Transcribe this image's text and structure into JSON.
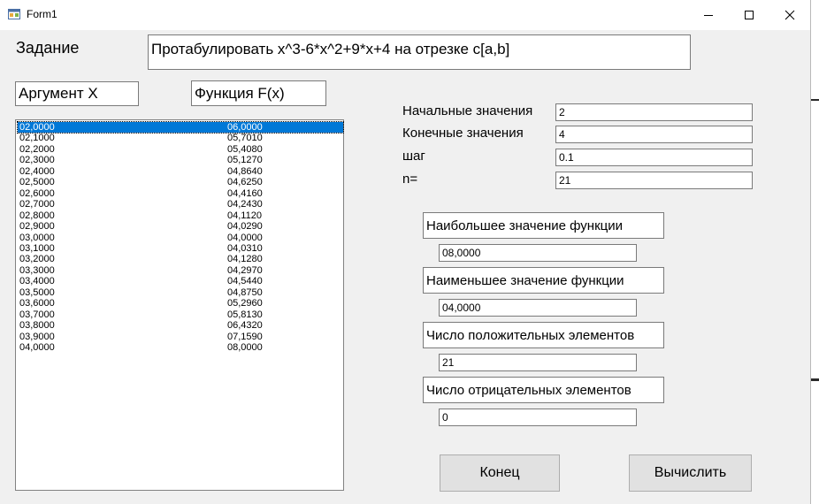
{
  "window": {
    "title": "Form1"
  },
  "task": {
    "label": "Задание",
    "text": "Протабулировать x^3-6*x^2+9*x+4 на отрезке c[a,b]"
  },
  "headers": {
    "argument": "Аргумент Х",
    "function": "Функция F(x)"
  },
  "table": {
    "rows": [
      {
        "x": "02,0000",
        "f": "06,0000"
      },
      {
        "x": "02,1000",
        "f": "05,7010"
      },
      {
        "x": "02,2000",
        "f": "05,4080"
      },
      {
        "x": "02,3000",
        "f": "05,1270"
      },
      {
        "x": "02,4000",
        "f": "04,8640"
      },
      {
        "x": "02,5000",
        "f": "04,6250"
      },
      {
        "x": "02,6000",
        "f": "04,4160"
      },
      {
        "x": "02,7000",
        "f": "04,2430"
      },
      {
        "x": "02,8000",
        "f": "04,1120"
      },
      {
        "x": "02,9000",
        "f": "04,0290"
      },
      {
        "x": "03,0000",
        "f": "04,0000"
      },
      {
        "x": "03,1000",
        "f": "04,0310"
      },
      {
        "x": "03,2000",
        "f": "04,1280"
      },
      {
        "x": "03,3000",
        "f": "04,2970"
      },
      {
        "x": "03,4000",
        "f": "04,5440"
      },
      {
        "x": "03,5000",
        "f": "04,8750"
      },
      {
        "x": "03,6000",
        "f": "05,2960"
      },
      {
        "x": "03,7000",
        "f": "05,8130"
      },
      {
        "x": "03,8000",
        "f": "06,4320"
      },
      {
        "x": "03,9000",
        "f": "07,1590"
      },
      {
        "x": "04,0000",
        "f": "08,0000"
      }
    ]
  },
  "params": {
    "start_label": "Начальные значения",
    "start_value": "2",
    "end_label": "Конечные значения",
    "end_value": "4",
    "step_label": "шаг",
    "step_value": "0.1",
    "n_label": "n=",
    "n_value": "21"
  },
  "results": {
    "max_label": "Наибольшее значение функции",
    "max_value": "08,0000",
    "min_label": "Наименьшее значение функции",
    "min_value": "04,0000",
    "pos_label": "Число положительных элементов",
    "pos_value": "21",
    "neg_label": "Число отрицательных элементов",
    "neg_value": "0"
  },
  "buttons": {
    "end": "Конец",
    "calc": "Вычислить"
  },
  "colors": {
    "selection": "#0078d7",
    "window_bg": "#f0f0f0"
  }
}
